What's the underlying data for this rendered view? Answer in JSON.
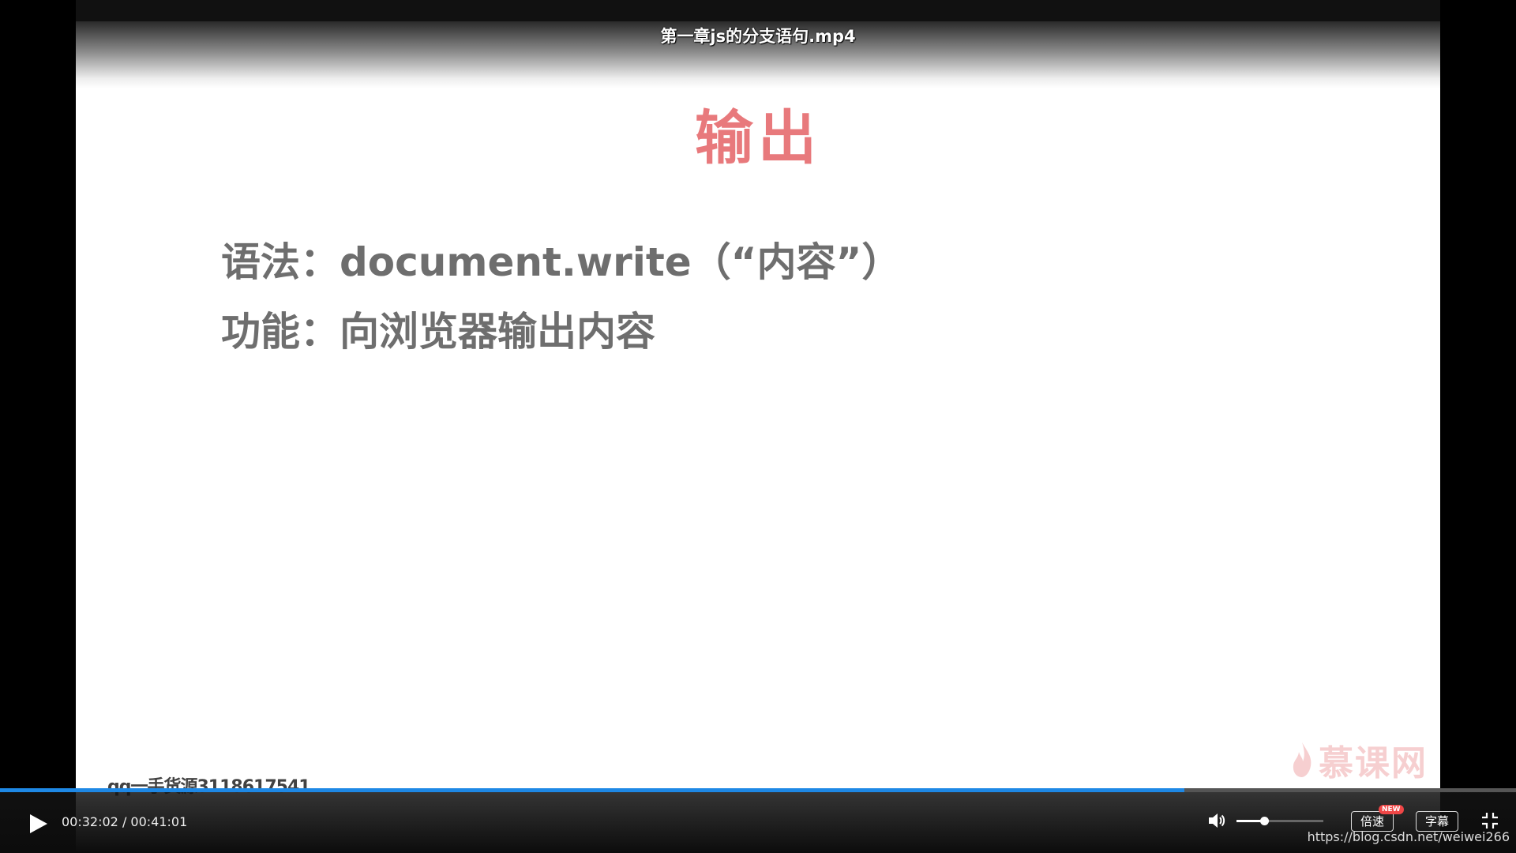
{
  "video": {
    "title": "第一章js的分支语句.mp4"
  },
  "slide": {
    "heading": "输出",
    "syntax_line": "语法：document.write（“内容”）",
    "function_line": "功能：向浏览器输出内容"
  },
  "watermarks": {
    "qq": "qq一手货源3118617541",
    "brand": "慕课网"
  },
  "controls": {
    "time": "00:32:02 / 00:41:01",
    "progress_fraction": 0.781,
    "volume_fraction": 0.32,
    "speed_label": "倍速",
    "new_badge": "NEW",
    "subtitle_label": "字幕",
    "accent_color": "#1e88e5"
  },
  "footer": {
    "url": "https://blog.csdn.net/weiwei266"
  },
  "colors": {
    "heading": "#e8797c",
    "body_text": "#6e6e6e"
  }
}
